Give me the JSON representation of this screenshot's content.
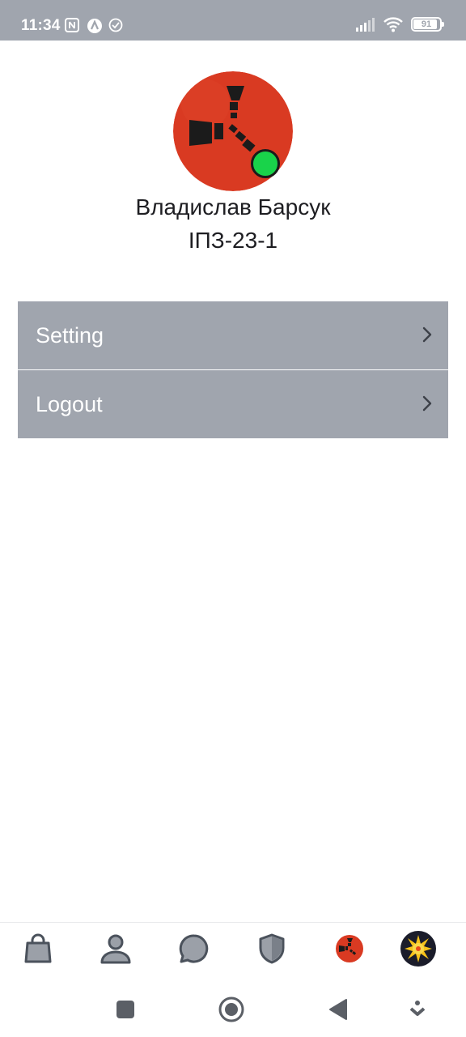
{
  "status_bar": {
    "time": "11:34",
    "battery": "91",
    "battery_level": 0.91,
    "icons": [
      "nfc-icon",
      "app-a-icon",
      "check-circle-icon",
      "signal-icon",
      "wifi-icon",
      "battery-icon"
    ]
  },
  "profile": {
    "name": "Владислав Барсук",
    "group": "ІПЗ-23-1",
    "online": true,
    "avatar_color": "#d93a22",
    "online_color": "#19d34a"
  },
  "menu": {
    "items": [
      {
        "label": "Setting"
      },
      {
        "label": "Logout"
      }
    ],
    "background": "#a0a5ae"
  },
  "tab_bar": {
    "tabs": [
      "bag-icon",
      "person-icon",
      "chat-icon",
      "shield-icon",
      "rust-logo-icon",
      "sun-icon"
    ]
  },
  "system_nav": {
    "buttons": [
      "recents-button",
      "home-button",
      "back-button",
      "assistant-button"
    ]
  }
}
